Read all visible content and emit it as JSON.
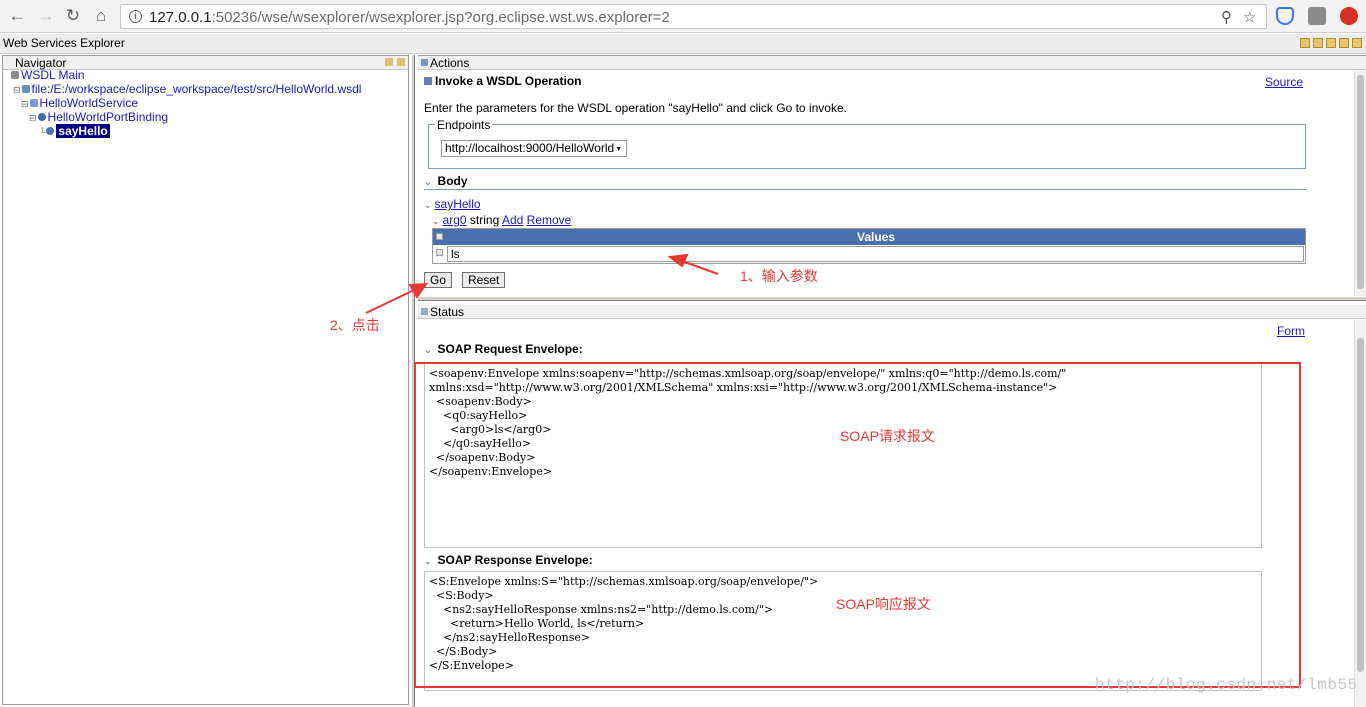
{
  "browser": {
    "url_host": "127.0.0.1",
    "url_rest": ":50236/wse/wsexplorer/wsexplorer.jsp?org.eclipse.wst.ws.explorer=2"
  },
  "app": {
    "title": "Web Services Explorer"
  },
  "navigator": {
    "title": "Navigator",
    "tree": {
      "root": "WSDL Main",
      "wsdl_file": "file:/E:/workspace/eclipse_workspace/test/src/HelloWorld.wsdl",
      "service": "HelloWorldService",
      "binding": "HelloWorldPortBinding",
      "operation": "sayHello"
    }
  },
  "actions": {
    "title": "Actions",
    "invoke_title": "Invoke a WSDL Operation",
    "source_link": "Source",
    "instructions_pre": "Enter the parameters for the WSDL operation \"sayHello\" and click ",
    "instructions_go": "Go",
    "instructions_post": " to invoke.",
    "endpoints_label": "Endpoints",
    "endpoint_value": "http://localhost:9000/HelloWorld",
    "body_label": "Body",
    "operation_link": "sayHello",
    "arg_name": "arg0",
    "arg_type": "string",
    "add_link": "Add",
    "remove_link": "Remove",
    "values_header": "Values",
    "value": "ls",
    "go_button": "Go",
    "reset_button": "Reset"
  },
  "status": {
    "title": "Status",
    "form_link": "Form",
    "request_label": "SOAP Request Envelope:",
    "request_xml": "<soapenv:Envelope xmlns:soapenv=\"http://schemas.xmlsoap.org/soap/envelope/\" xmlns:q0=\"http://demo.ls.com/\"\nxmlns:xsd=\"http://www.w3.org/2001/XMLSchema\" xmlns:xsi=\"http://www.w3.org/2001/XMLSchema-instance\">\n  <soapenv:Body>\n    <q0:sayHello>\n      <arg0>ls</arg0>\n    </q0:sayHello>\n  </soapenv:Body>\n</soapenv:Envelope>",
    "response_label": "SOAP Response Envelope:",
    "response_xml": "<S:Envelope xmlns:S=\"http://schemas.xmlsoap.org/soap/envelope/\">\n  <S:Body>\n    <ns2:sayHelloResponse xmlns:ns2=\"http://demo.ls.com/\">\n      <return>Hello World, ls</return>\n    </ns2:sayHelloResponse>\n  </S:Body>\n</S:Envelope>"
  },
  "annotations": {
    "step1": "1、输入参数",
    "step2": "2、点击",
    "request_note": "SOAP请求报文",
    "response_note": "SOAP响应报文",
    "color": "#e53935"
  },
  "watermark": "http://blog.csdn.net/lmb55"
}
